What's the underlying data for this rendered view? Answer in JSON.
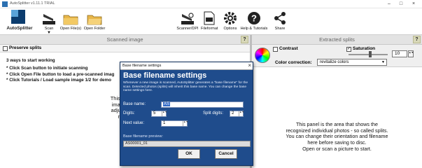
{
  "window": {
    "title": "AutoSplitter v1.11.1 TRIAL",
    "minimize": "–",
    "maximize": "□",
    "close": "×"
  },
  "toolbar": {
    "app_name": "AutoSplitter",
    "scan": "Scan",
    "open_file": "Open File(s)",
    "open_folder": "Open Folder",
    "scanner_dpi": "Scanner/DPI",
    "fileformat": "Fileformat",
    "options": "Options",
    "help_tutorials": "Help & Tutorials",
    "share": "Share",
    "dropdown_caret": "▼"
  },
  "left_panel": {
    "header": "Scanned image",
    "help": "?",
    "preserve_splits": "Preserve splits",
    "steps_heading": "3 ways to start working",
    "steps": [
      "* Click Scan button to initiate scanning",
      "* Click Open File button to load a pre-scanned imag",
      "* Click Tutorials / Load sample image 1/2 for demo"
    ],
    "hint_lines": [
      "This panel is the",
      "image. Scan or",
      "adjust the detec",
      "mouse he"
    ]
  },
  "right_panel": {
    "header": "Extracted splits",
    "help": "?",
    "contrast": "Contrast",
    "saturation": "Saturation",
    "saturation_value": "10",
    "color_correction_label": "Color correction:",
    "color_correction_value": "revitalize colors",
    "hint_lines": [
      "This panel is the area that shows the",
      "recognized individual photos - so called splits.",
      "You can change their orientation and filename",
      "here before saving to disc.",
      "Open or scan a picture to start."
    ]
  },
  "dialog": {
    "window_title": "Base filename settings",
    "close": "×",
    "heading": "Base filename settings",
    "description": "Whenever a new image is scanned, AutoSplitter generates a \"base filename\" for the scan. Detected photos (splits) will inherit this base name. You can change the base name settings here.",
    "base_name_label": "Base name:",
    "base_name_value": "AS",
    "digits_label": "Digits:",
    "digits_value": "5",
    "split_digits_label": "Split digits:",
    "split_digits_value": "2",
    "next_value_label": "Next value:",
    "next_value": "1",
    "preview_label": "Base filename preview:",
    "preview_value": "AS00001_01",
    "ok": "OK",
    "cancel": "Cancel",
    "spin_arrows": "▲▼"
  },
  "colors": {
    "dialog_bg": "#1f4c8c",
    "panel_header": "#e3e3e3",
    "help_icon": "#d8d8b8"
  }
}
